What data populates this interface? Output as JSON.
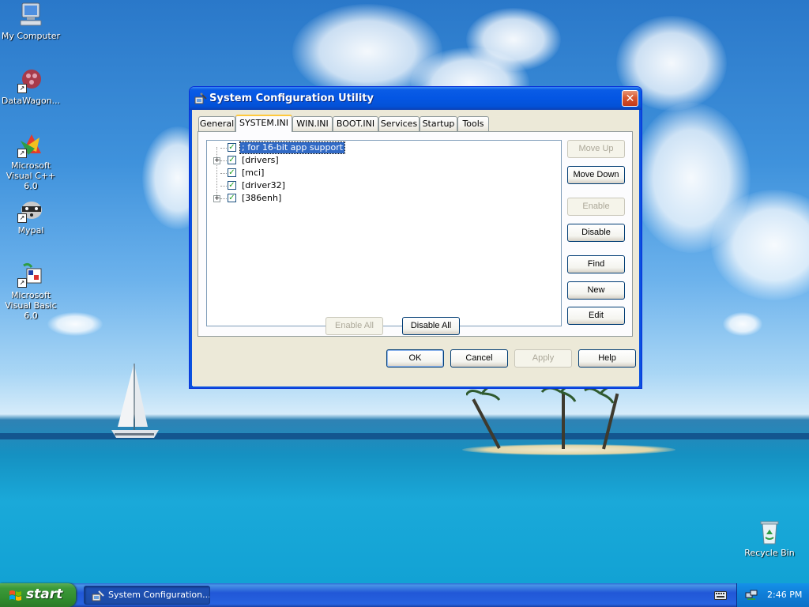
{
  "desktop": {
    "icons": [
      {
        "label": "My Computer",
        "icon": "computer-icon"
      },
      {
        "label": "DataWagon...",
        "icon": "datawagon-icon"
      },
      {
        "label": "Microsoft Visual C++ 6.0",
        "icon": "visual-cpp-icon"
      },
      {
        "label": "Mypal",
        "icon": "mypal-raccoon-icon"
      },
      {
        "label": "Microsoft Visual Basic 6.0",
        "icon": "visual-basic-icon"
      },
      {
        "label": "Recycle Bin",
        "icon": "recycle-bin-icon"
      }
    ]
  },
  "window": {
    "title": "System Configuration Utility",
    "close_symbol": "✕",
    "tabs": [
      {
        "label": "General",
        "active": false
      },
      {
        "label": "SYSTEM.INI",
        "active": true
      },
      {
        "label": "WIN.INI",
        "active": false
      },
      {
        "label": "BOOT.INI",
        "active": false
      },
      {
        "label": "Services",
        "active": false
      },
      {
        "label": "Startup",
        "active": false
      },
      {
        "label": "Tools",
        "active": false
      }
    ],
    "tree": [
      {
        "label": "; for 16-bit app support",
        "checked": true,
        "expandable": false,
        "selected": true
      },
      {
        "label": "[drivers]",
        "checked": true,
        "expandable": true,
        "selected": false
      },
      {
        "label": "[mci]",
        "checked": true,
        "expandable": false,
        "selected": false
      },
      {
        "label": "[driver32]",
        "checked": true,
        "expandable": false,
        "selected": false
      },
      {
        "label": "[386enh]",
        "checked": true,
        "expandable": true,
        "selected": false
      }
    ],
    "side_buttons": [
      {
        "label": "Move Up",
        "enabled": false
      },
      {
        "label": "Move Down",
        "enabled": true
      },
      {
        "label": "Enable",
        "enabled": false
      },
      {
        "label": "Disable",
        "enabled": true
      },
      {
        "label": "Find",
        "enabled": true
      },
      {
        "label": "New",
        "enabled": true
      },
      {
        "label": "Edit",
        "enabled": true
      }
    ],
    "bottom_buttons": [
      {
        "label": "Enable All",
        "enabled": false
      },
      {
        "label": "Disable All",
        "enabled": true
      }
    ],
    "dialog_buttons": [
      {
        "label": "OK",
        "enabled": true,
        "default": true
      },
      {
        "label": "Cancel",
        "enabled": true,
        "default": false
      },
      {
        "label": "Apply",
        "enabled": false,
        "default": false
      },
      {
        "label": "Help",
        "enabled": true,
        "default": false
      }
    ]
  },
  "taskbar": {
    "start_label": "start",
    "task_label": "System Configuration...",
    "clock": "2:46 PM"
  }
}
